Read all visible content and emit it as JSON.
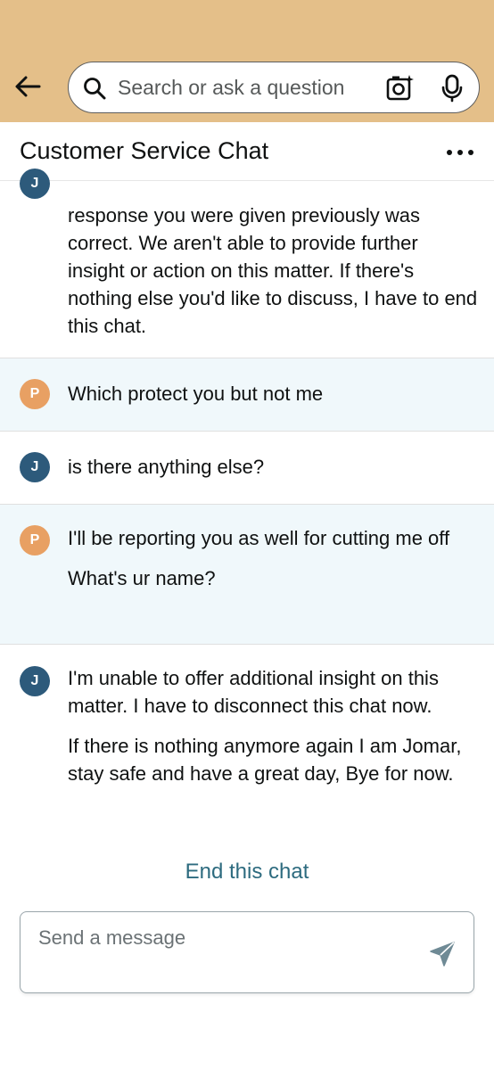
{
  "search": {
    "placeholder": "Search or ask a question"
  },
  "chat": {
    "title": "Customer Service Chat"
  },
  "messages": [
    {
      "sender": "J",
      "lines": [
        "response you were given previously was correct. We aren't able to provide further insight or action on this matter. If there's nothing else you'd like to discuss, I have to end this chat."
      ]
    },
    {
      "sender": "P",
      "lines": [
        "Which protect you but not me"
      ]
    },
    {
      "sender": "J",
      "lines": [
        "is there anything else?"
      ]
    },
    {
      "sender": "P",
      "lines": [
        "I'll be reporting you as well for cutting me off",
        "What's ur name?"
      ]
    },
    {
      "sender": "J",
      "lines": [
        "I'm unable to offer additional insight on this matter. I have to disconnect this chat now.",
        "If there is nothing anymore again I am Jomar, stay safe and have a great day, Bye for now."
      ]
    }
  ],
  "end_chat_label": "End this chat",
  "composer": {
    "placeholder": "Send a message"
  },
  "colors": {
    "header_bg": "#e4bf89",
    "agent_avatar": "#2d5a7b",
    "user_avatar": "#e8a063",
    "user_bubble_bg": "#f0f8fb",
    "link": "#2d6b7f"
  },
  "icons": {
    "back": "arrow-left-icon",
    "search": "magnifier-icon",
    "camera": "camera-sparkle-icon",
    "mic": "microphone-icon",
    "more": "ellipsis-icon",
    "send": "paper-plane-icon"
  }
}
